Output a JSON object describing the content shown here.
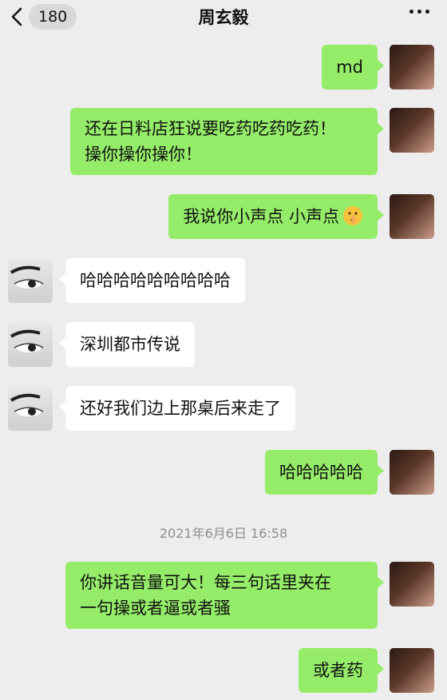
{
  "header": {
    "back_count": "180",
    "title": "周玄毅"
  },
  "messages": [
    {
      "side": "me",
      "text": "md"
    },
    {
      "side": "me",
      "line1": "还在日料店狂说要吃药吃药吃药！",
      "line2": "操你操你操你！"
    },
    {
      "side": "me",
      "text": "我说你小声点 小声点",
      "emoji": "shushing-face-icon"
    },
    {
      "side": "other",
      "text": "哈哈哈哈哈哈哈哈哈"
    },
    {
      "side": "other",
      "text": "深圳都市传说"
    },
    {
      "side": "other",
      "text": "还好我们边上那桌后来走了"
    },
    {
      "side": "me",
      "text": "哈哈哈哈哈"
    },
    {
      "side": "me",
      "line1": "你讲话音量可大！每三句话里夹在",
      "line2": "一句操或者逼或者骚"
    },
    {
      "side": "me",
      "text": "或者药"
    }
  ],
  "timestamp": "2021年6月6日 16:58",
  "colors": {
    "background": "#ededed",
    "my_bubble": "#95ec69",
    "other_bubble": "#ffffff",
    "timestamp_text": "#8f8f8f"
  }
}
